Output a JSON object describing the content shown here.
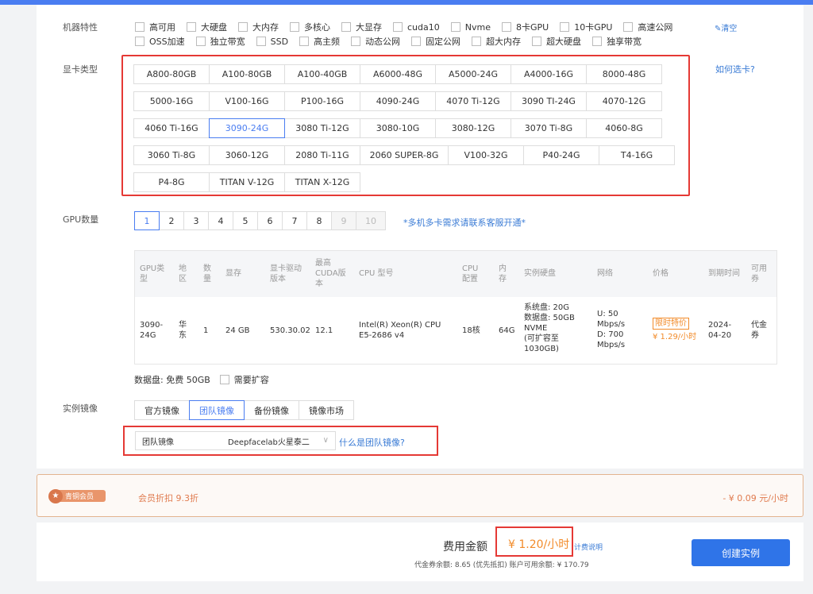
{
  "labels": {
    "features": "机器特性",
    "gpu_type": "显卡类型",
    "gpu_count": "GPU数量",
    "image": "实例镜像"
  },
  "features": {
    "row1": [
      "高可用",
      "大硬盘",
      "大内存",
      "多核心",
      "大显存",
      "cuda10",
      "Nvme",
      "8卡GPU",
      "10卡GPU",
      "高速公网"
    ],
    "row2": [
      "OSS加速",
      "独立带宽",
      "SSD",
      "高主频",
      "动态公网",
      "固定公网",
      "超大内存",
      "超大硬盘",
      "独享带宽"
    ],
    "clear": "清空"
  },
  "gpu_types": {
    "rows": [
      [
        "A800-80GB",
        "A100-80GB",
        "A100-40GB",
        "A6000-48G",
        "A5000-24G",
        "A4000-16G",
        "8000-48G"
      ],
      [
        "5000-16G",
        "V100-16G",
        "P100-16G",
        "4090-24G",
        "4070 Ti-12G",
        "3090 TI-24G",
        "4070-12G"
      ],
      [
        "4060 Ti-16G",
        "3090-24G",
        "3080 Ti-12G",
        "3080-10G",
        "3080-12G",
        "3070 Ti-8G",
        "4060-8G"
      ],
      [
        "3060 Ti-8G",
        "3060-12G",
        "2080 Ti-11G",
        "2060 SUPER-8G",
        "V100-32G",
        "P40-24G",
        "T4-16G"
      ],
      [
        "P4-8G",
        "TITAN V-12G",
        "TITAN X-12G"
      ]
    ],
    "selected": "3090-24G",
    "howto": "如何选卡?"
  },
  "gpu_count": {
    "options": [
      "1",
      "2",
      "3",
      "4",
      "5",
      "6",
      "7",
      "8",
      "9",
      "10"
    ],
    "selected": "1",
    "note": "*多机多卡需求请联系客服开通*"
  },
  "spec_table": {
    "headers": {
      "gpu_type": "GPU类型",
      "region": "地区",
      "count": "数量",
      "vram": "显存",
      "driver": "显卡驱动版本",
      "cuda": "最高CUDA版本",
      "cpu": "CPU 型号",
      "cpu_cfg": "CPU配置",
      "mem": "内存",
      "disk": "实例硬盘",
      "net": "网络",
      "price": "价格",
      "expire": "到期时间",
      "coupon": "可用券"
    },
    "row": {
      "gpu_type": "3090-24G",
      "region": "华东",
      "count": "1",
      "vram": "24 GB",
      "driver": "530.30.02",
      "cuda": "12.1",
      "cpu": "Intel(R) Xeon(R) CPU E5-2686 v4",
      "cpu_cfg": "18核",
      "mem": "64G",
      "disk_sys": "系统盘: 20G",
      "disk_data": "数据盘: 50GB NVME",
      "disk_ext": "(可扩容至1030GB)",
      "net_up": "U: 50 Mbps/s",
      "net_down": "D: 700 Mbps/s",
      "promo": "限时特价",
      "price": "¥ 1.29/小时",
      "expire": "2024-04-20",
      "coupon": "代金券"
    }
  },
  "data_disk": {
    "text": "数据盘: 免费 50GB",
    "expand": "需要扩容"
  },
  "image": {
    "tabs": [
      "官方镜像",
      "团队镜像",
      "备份镜像",
      "镜像市场"
    ],
    "selected_tab": "团队镜像",
    "select_type": "团队镜像",
    "select_value": "Deepfacelab火星泰二",
    "whatis": "什么是团队镜像?"
  },
  "member": {
    "badge": "青铜会员",
    "discount": "会员折扣 9.3折",
    "save": "- ¥ 0.09 元/小时"
  },
  "fee": {
    "label": "费用金额",
    "amount": "¥ 1.20/小时",
    "desc": "计费说明",
    "balance": "代金券余额: 8.65 (优先抵扣)   账户可用余额: ¥ 170.79",
    "create": "创建实例"
  },
  "colors": {
    "accent": "#4a7df1",
    "highlight_box": "#e53935",
    "price": "#f28b2a",
    "link": "#3a7bd5"
  }
}
